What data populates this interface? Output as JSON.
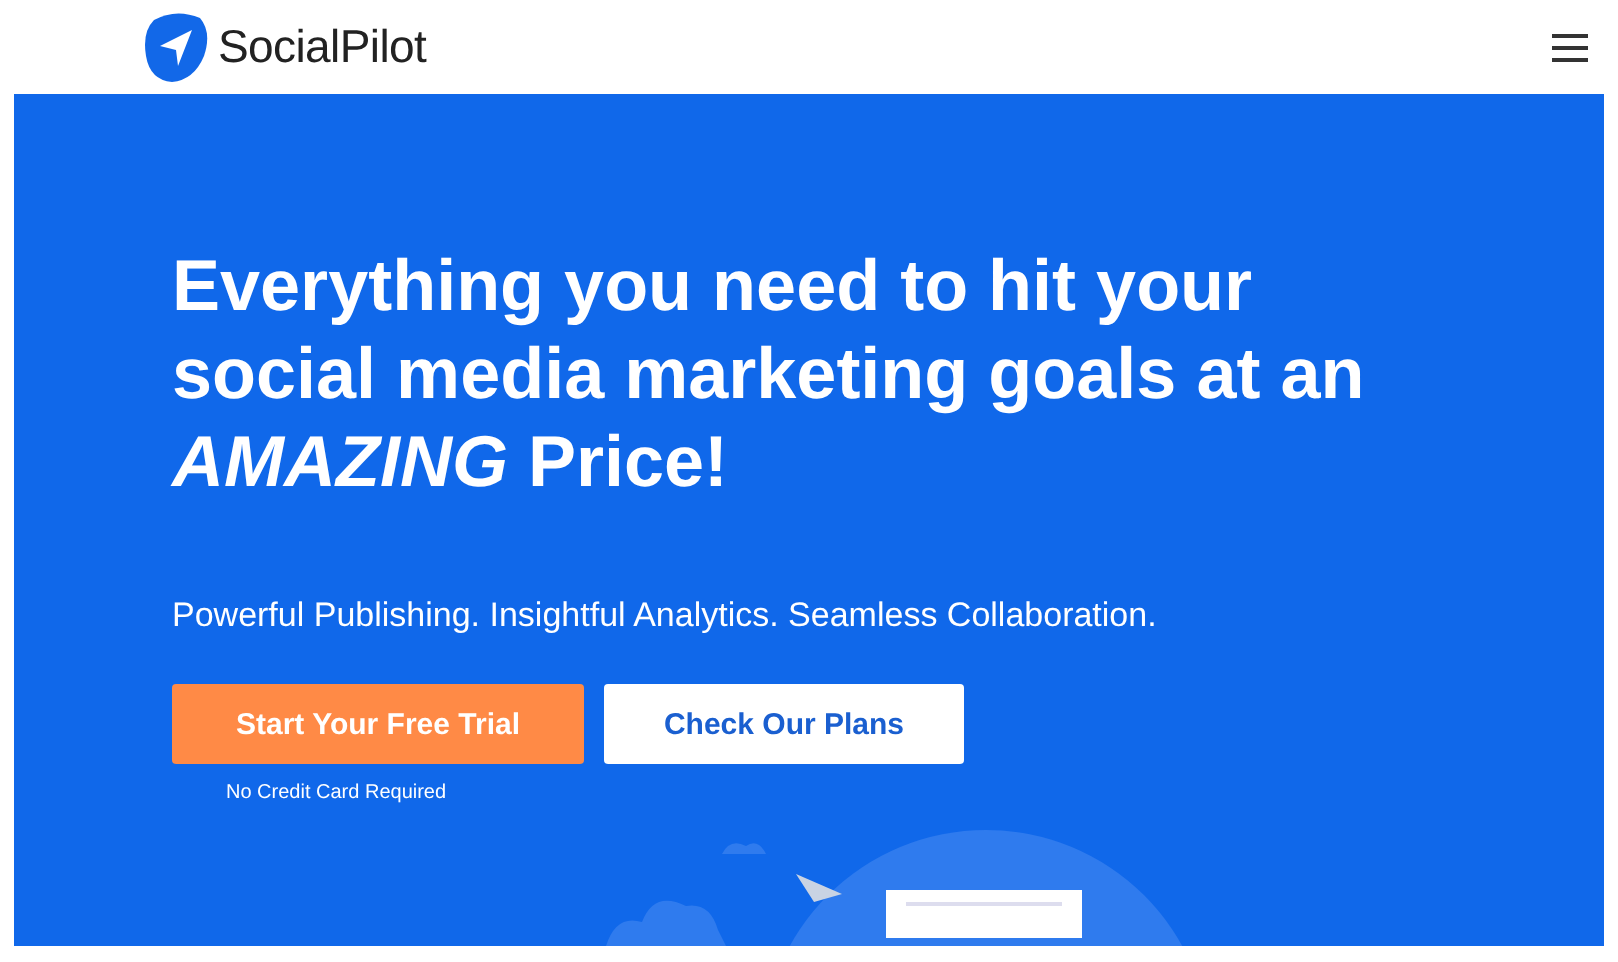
{
  "header": {
    "brand": "SocialPilot"
  },
  "hero": {
    "headline": "Everything you need to hit your social media marketing goals at an *AMAZING* Price!",
    "subheadline": "Powerful Publishing. Insightful Analytics. Seamless Collaboration.",
    "buttons": [
      {
        "label": "Start Your Free Trial",
        "kind": "primary"
      },
      {
        "label": "Check Our Plans",
        "kind": "secondary"
      }
    ],
    "note": "No Credit Card Required"
  }
}
